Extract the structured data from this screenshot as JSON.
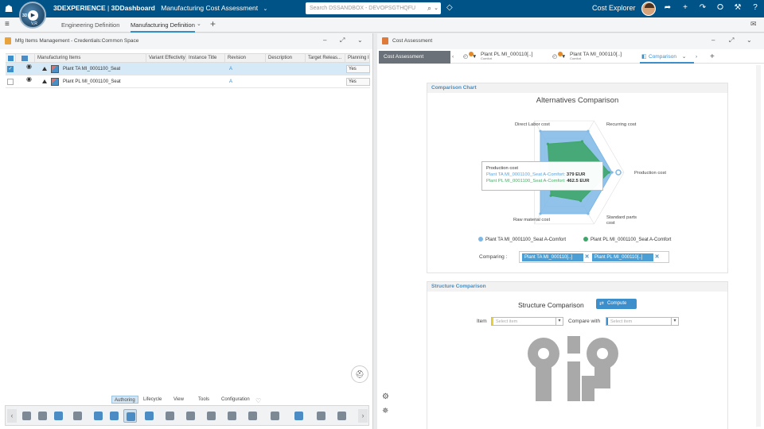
{
  "topbar": {
    "brand_prefix": "3DEXPERIENCE",
    "brand_sep": " | ",
    "brand_dash": "3DDashboard",
    "dashboard_name": "Manufacturing Cost Assessment",
    "search_placeholder": "Search DSSANDBOX - DEVOPSGTHQFU",
    "compass_3d": "3D",
    "compass_v": "V,R",
    "app_name": "Cost Explorer",
    "icons": [
      "share-icon",
      "plus-icon",
      "forward-icon",
      "network-icon",
      "tools-icon",
      "help-icon"
    ]
  },
  "subbar": {
    "tabs": [
      "Engineering Definition",
      "Manufacturing Definition"
    ],
    "active_tab": 1
  },
  "left_panel": {
    "title": "Mfg Items Management - Credentials:Common Space",
    "columns": [
      "Manufacturing Items",
      "Variant Effectivity",
      "Instance Title",
      "Revision",
      "Description",
      "Target Releas...",
      "Planning I"
    ],
    "rows": [
      {
        "name": "Plant TA MI_0001100_Seat",
        "revision": "A",
        "planning": "Yes",
        "selected": true
      },
      {
        "name": "Plant PL MI_0001100_Seat",
        "revision": "A",
        "planning": "Yes",
        "selected": false
      }
    ],
    "toolbar_tabs": [
      "Authoring",
      "Lifecycle",
      "View",
      "Tools",
      "Configuration"
    ],
    "active_toolbar_tab": 0
  },
  "right_panel": {
    "title": "Cost Assessment",
    "tabs": [
      {
        "label": "Cost Assessment"
      },
      {
        "label": "Plant PL MI_000110[..]",
        "sub": "Comfort"
      },
      {
        "label": "Plant TA MI_000110[..]",
        "sub": "Comfort"
      },
      {
        "label": "Comparison"
      }
    ],
    "comparison_chart": {
      "section_title": "Comparison Chart",
      "comparing_label": "Comparing :",
      "chips": [
        "Plant TA MI_000110[..]",
        "Plant PL MI_000110[..]"
      ],
      "tooltip": {
        "title": "Production cost",
        "line1_label": "Plant TA MI_0001100_Seat A-Comfort:",
        "line1_value": "379 EUR",
        "line2_label": "Plant PL MI_0001100_Seat A-Comfort:",
        "line2_value": "462.5 EUR"
      }
    },
    "structure_comparison": {
      "section_title": "Structure Comparison",
      "title": "Structure Comparison",
      "compute_label": "Compute",
      "item_label": "Item",
      "compare_label": "Compare with",
      "item_placeholder": "Select item",
      "compare_placeholder": "Select item"
    }
  },
  "chart_data": {
    "type": "radar",
    "title": "Alternatives Comparison",
    "categories": [
      "Direct Labor cost",
      "Recurring cost",
      "Production cost",
      "Standard parts cost",
      "Raw material cost"
    ],
    "series": [
      {
        "name": "Plant TA MI_0001100_Seat A-Comfort",
        "color": "#7db7e6",
        "values": [
          0.8,
          0.8,
          0.8,
          0.8,
          0.8
        ]
      },
      {
        "name": "Plant PL MI_0001100_Seat A-Comfort",
        "color": "#3fa66b",
        "values": [
          0.55,
          0.6,
          0.75,
          0.55,
          0.45
        ]
      }
    ]
  }
}
